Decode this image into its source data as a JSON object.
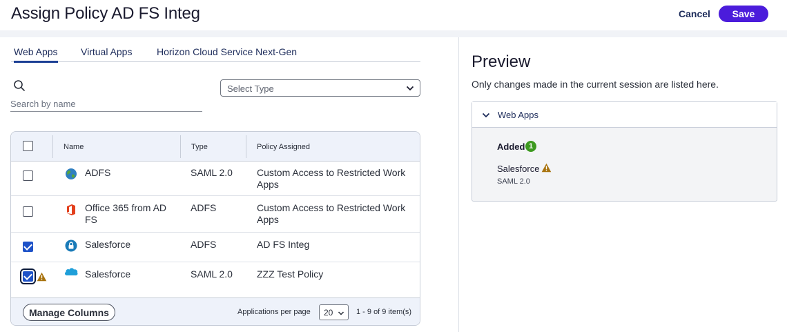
{
  "header": {
    "title": "Assign Policy AD FS Integ",
    "cancel_label": "Cancel",
    "save_label": "Save"
  },
  "tabs": [
    {
      "label": "Web Apps",
      "active": true
    },
    {
      "label": "Virtual Apps",
      "active": false
    },
    {
      "label": "Horizon Cloud Service Next-Gen",
      "active": false
    }
  ],
  "search": {
    "placeholder": "Search by name",
    "icon": "search-icon"
  },
  "type_select": {
    "placeholder": "Select Type"
  },
  "table": {
    "columns": [
      "Name",
      "Type",
      "Policy Assigned"
    ],
    "rows": [
      {
        "name_lines": [
          "ADFS"
        ],
        "type": "SAML 2.0",
        "policy_lines": [
          "Custom Access to Restricted Work",
          "Apps"
        ],
        "checked": false,
        "icon": "globe-icon",
        "warning": false
      },
      {
        "name_lines": [
          "Office 365 from AD",
          "FS"
        ],
        "type": "ADFS",
        "policy_lines": [
          "Custom Access to Restricted Work",
          "Apps"
        ],
        "checked": false,
        "icon": "office-icon",
        "warning": false
      },
      {
        "name_lines": [
          "Salesforce"
        ],
        "type": "ADFS",
        "policy_lines": [
          "AD FS Integ"
        ],
        "checked": true,
        "icon": "lock-icon",
        "warning": false
      },
      {
        "name_lines": [
          "Salesforce"
        ],
        "type": "SAML 2.0",
        "policy_lines": [
          "ZZZ Test Policy"
        ],
        "checked": true,
        "icon": "salesforce-cloud-icon",
        "warning": true
      }
    ],
    "footer": {
      "manage_columns_label": "Manage Columns",
      "per_page_label": "Applications per page",
      "per_page_value": "20",
      "pagination_text": "1 - 9 of 9 item(s)"
    }
  },
  "preview": {
    "title": "Preview",
    "subtitle": "Only changes made in the current session are listed here.",
    "section_title": "Web Apps",
    "added_label": "Added",
    "added_count": "1",
    "app_name": "Salesforce",
    "app_type": "SAML 2.0"
  },
  "colors": {
    "primary": "#4b1cdb",
    "checkbox_checked": "#1e52c8",
    "warning": "#b07a12",
    "success": "#3d9a20",
    "link": "#1c2b5a"
  }
}
